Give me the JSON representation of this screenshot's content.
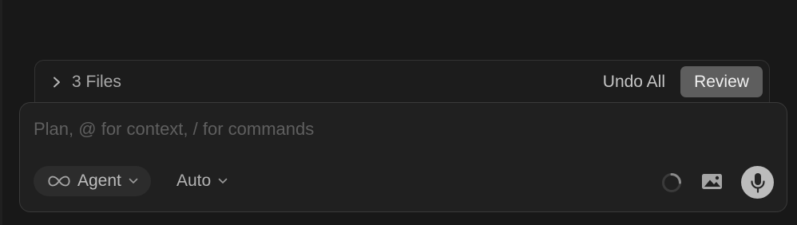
{
  "files_bar": {
    "files_label": "3 Files",
    "undo_all_label": "Undo All",
    "review_label": "Review"
  },
  "composer": {
    "prompt_placeholder": "Plan, @ for context, / for commands",
    "prompt_value": "",
    "mode_label": "Agent",
    "model_label": "Auto"
  },
  "icons": {
    "expand": "chevron-right-icon",
    "mode": "infinity-icon",
    "mode_dropdown": "chevron-down-icon",
    "model_dropdown": "chevron-down-icon",
    "status": "loading-spinner-icon",
    "attach": "image-icon",
    "voice": "microphone-icon"
  },
  "colors": {
    "background": "#181818",
    "composer_bg": "#202020",
    "review_button_bg": "#5e5e5e",
    "mode_pill_bg": "#2c2c2c",
    "mic_button_bg": "#bcbcbc"
  }
}
